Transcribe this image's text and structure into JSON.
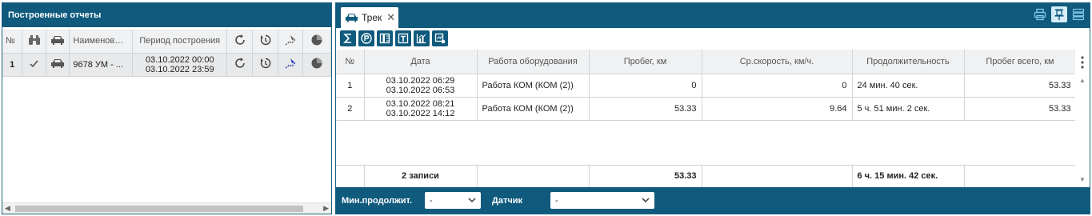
{
  "left_panel": {
    "title": "Построенные отчеты",
    "columns": {
      "num": "№",
      "name": "Наименов…",
      "period": "Период построения"
    },
    "rows": [
      {
        "num": "1",
        "checked": true,
        "name": "9678 УМ - ...",
        "period_from": "03.10.2022 00:00",
        "period_to": "03.10.2022 23:59"
      }
    ]
  },
  "right_panel": {
    "tab": {
      "label": "Трек",
      "close": "✕"
    },
    "columns": {
      "num": "№",
      "date": "Дата",
      "work": "Работа оборудования",
      "mileage": "Пробег, км",
      "avg_speed": "Ср.скорость, км/ч.",
      "duration": "Продолжительность",
      "mileage_total": "Пробег всего, км"
    },
    "rows": [
      {
        "num": "1",
        "date_from": "03.10.2022 06:29",
        "date_to": "03.10.2022 06:53",
        "work": "Работа КОМ (КОМ (2))",
        "mileage": "0",
        "avg_speed": "0",
        "duration": "24 мин. 40 сек.",
        "mileage_total": "53.33"
      },
      {
        "num": "2",
        "date_from": "03.10.2022 08:21",
        "date_to": "03.10.2022 14:12",
        "work": "Работа КОМ (КОМ (2))",
        "mileage": "53.33",
        "avg_speed": "9.64",
        "duration": "5 ч. 51 мин. 2 сек.",
        "mileage_total": "53.33"
      }
    ],
    "totals": {
      "count": "2 записи",
      "mileage": "53.33",
      "duration": "6 ч. 15 мин. 42 сек."
    },
    "footer": {
      "min_duration_label": "Мин.продолжит.",
      "min_duration_value": "-",
      "sensor_label": "Датчик",
      "sensor_value": "-"
    }
  },
  "colors": {
    "header_bg": "#0f5a7d",
    "selected_row": "#e8e9ea",
    "grid_header": "#f0f1f2"
  }
}
